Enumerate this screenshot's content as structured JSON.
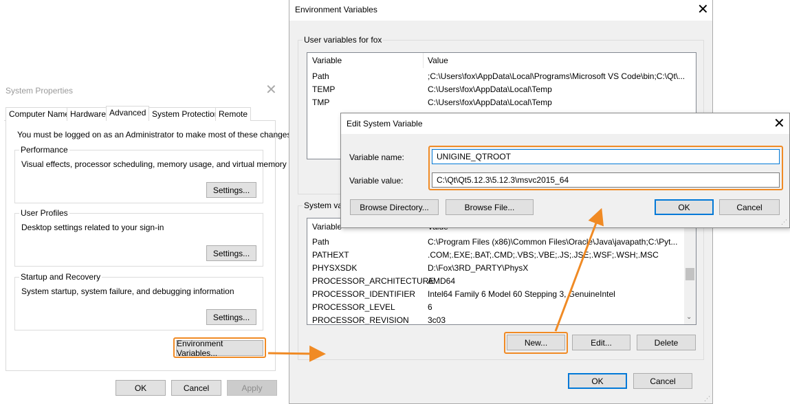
{
  "system_properties": {
    "title": "System Properties",
    "tabs": [
      "Computer Name",
      "Hardware",
      "Advanced",
      "System Protection",
      "Remote"
    ],
    "admin_note": "You must be logged on as an Administrator to make most of these changes.",
    "performance": {
      "label": "Performance",
      "desc": "Visual effects, processor scheduling, memory usage, and virtual memory",
      "button": "Settings..."
    },
    "user_profiles": {
      "label": "User Profiles",
      "desc": "Desktop settings related to your sign-in",
      "button": "Settings..."
    },
    "startup": {
      "label": "Startup and Recovery",
      "desc": "System startup, system failure, and debugging information",
      "button": "Settings..."
    },
    "env_button": "Environment Variables...",
    "ok": "OK",
    "cancel": "Cancel",
    "apply": "Apply"
  },
  "env_vars": {
    "title": "Environment Variables",
    "user_group": "User variables for fox",
    "system_group": "System va",
    "col_variable": "Variable",
    "col_value": "Value",
    "user_rows": [
      {
        "var": "Path",
        "val": ";C:\\Users\\fox\\AppData\\Local\\Programs\\Microsoft VS Code\\bin;C:\\Qt\\..."
      },
      {
        "var": "TEMP",
        "val": "C:\\Users\\fox\\AppData\\Local\\Temp"
      },
      {
        "var": "TMP",
        "val": "C:\\Users\\fox\\AppData\\Local\\Temp"
      }
    ],
    "system_rows": [
      {
        "var": "Path",
        "val": "C:\\Program Files (x86)\\Common Files\\Oracle\\Java\\javapath;C:\\Pyt..."
      },
      {
        "var": "PATHEXT",
        "val": ".COM;.EXE;.BAT;.CMD;.VBS;.VBE;.JS;.JSE;.WSF;.WSH;.MSC"
      },
      {
        "var": "PHYSXSDK",
        "val": "D:\\Fox\\3RD_PARTY\\PhysX"
      },
      {
        "var": "PROCESSOR_ARCHITECTURE",
        "val": "AMD64"
      },
      {
        "var": "PROCESSOR_IDENTIFIER",
        "val": "Intel64 Family 6 Model 60 Stepping 3, GenuineIntel"
      },
      {
        "var": "PROCESSOR_LEVEL",
        "val": "6"
      },
      {
        "var": "PROCESSOR_REVISION",
        "val": "3c03"
      }
    ],
    "new_button": "New...",
    "edit_button": "Edit...",
    "delete_button": "Delete",
    "ok": "OK",
    "cancel": "Cancel"
  },
  "edit_dialog": {
    "title": "Edit System Variable",
    "name_label": "Variable name:",
    "name_value": "UNIGINE_QTROOT",
    "value_label": "Variable value:",
    "value_value": "C:\\Qt\\Qt5.12.3\\5.12.3\\msvc2015_64",
    "browse_dir": "Browse Directory...",
    "browse_file": "Browse File...",
    "ok": "OK",
    "cancel": "Cancel"
  },
  "colors": {
    "accent": "#0078d7",
    "highlight": "#f08a24"
  }
}
